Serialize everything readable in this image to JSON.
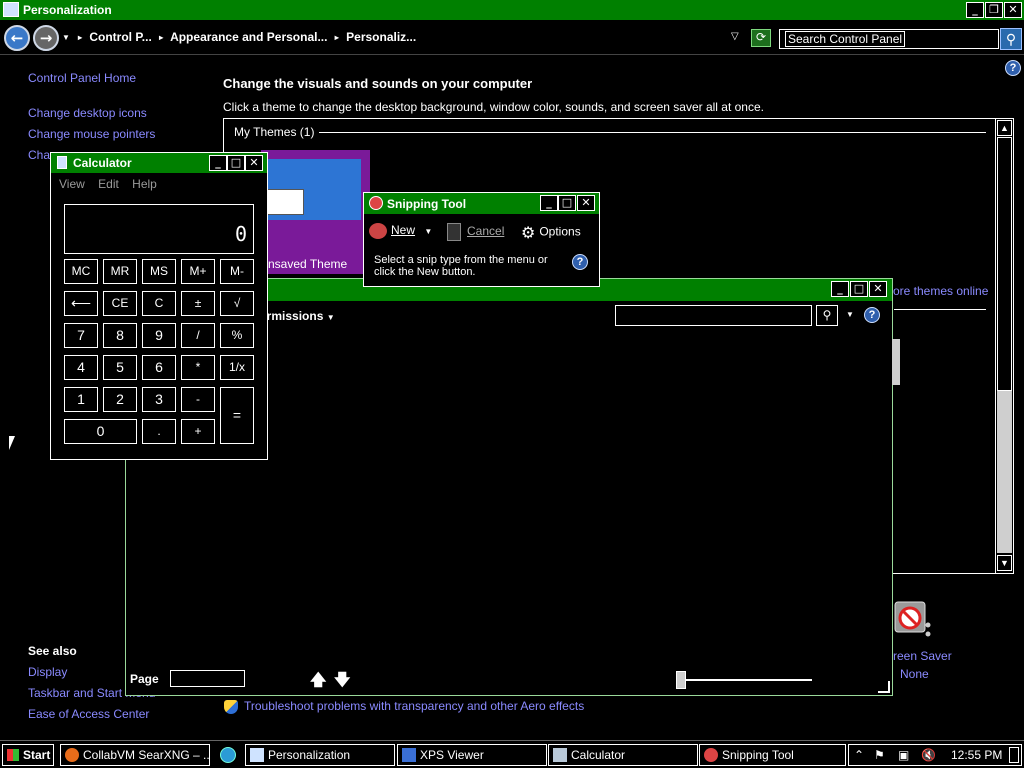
{
  "window": {
    "title": "Personalization",
    "controls": {
      "minimize": "_",
      "restore": "❐",
      "close": "✕"
    }
  },
  "address": {
    "back": "←",
    "forward": "→",
    "crumbs": [
      "Control P...",
      "Appearance and Personal...",
      "Personaliz..."
    ],
    "search_placeholder": "Search Control Panel"
  },
  "left_nav": {
    "home": "Control Panel Home",
    "links": [
      "Change desktop icons",
      "Change mouse pointers",
      "Char"
    ],
    "see_also_heading": "See also",
    "see_also": [
      "Display",
      "Taskbar and Start Menu",
      "Ease of Access Center"
    ]
  },
  "content": {
    "heading": "Change the visuals and sounds on your computer",
    "subheading": "Click a theme to change the desktop background, window color, sounds, and screen saver all at once.",
    "themes_group": "My Themes (1)",
    "theme_name": "nsaved Theme",
    "more_themes": "ore themes online",
    "screen_saver_label": "reen Saver",
    "screen_saver_value": "None",
    "troubleshoot": "Troubleshoot problems with transparency and other Aero effects",
    "help": "?"
  },
  "xps_viewer": {
    "permissions": "ermissions",
    "page_label": "Page"
  },
  "calculator": {
    "title": "Calculator",
    "menu": [
      "View",
      "Edit",
      "Help"
    ],
    "display": "0",
    "keys": [
      [
        "MC",
        "MR",
        "MS",
        "M+",
        "M-"
      ],
      [
        "⟵",
        "CE",
        "C",
        "±",
        "√"
      ],
      [
        "7",
        "8",
        "9",
        "/",
        "%"
      ],
      [
        "4",
        "5",
        "6",
        "*",
        "1/x"
      ],
      [
        "1",
        "2",
        "3",
        "-",
        "="
      ],
      [
        "0",
        ".",
        "+"
      ]
    ]
  },
  "snipping_tool": {
    "title": "Snipping Tool",
    "new": "New",
    "cancel": "Cancel",
    "options": "Options",
    "message": "Select a snip type from the menu or click the New button."
  },
  "taskbar": {
    "start": "Start",
    "tasks": [
      "CollabVM SearXNG – ...",
      "Personalization",
      "XPS Viewer",
      "Calculator",
      "Snipping Tool"
    ],
    "clock": "12:55 PM"
  },
  "colors": {
    "titlebar": "#008000",
    "link": "#8a8aff",
    "background": "#000000"
  }
}
